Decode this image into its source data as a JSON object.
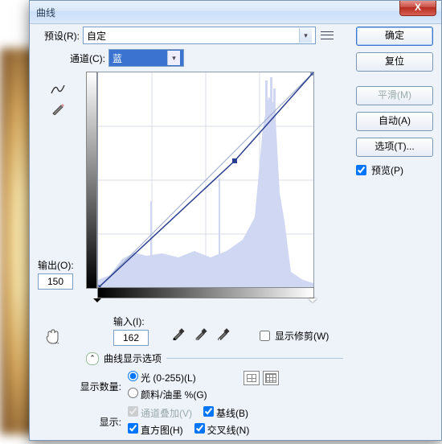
{
  "window": {
    "title": "曲线",
    "close": "X"
  },
  "preset": {
    "label": "预设(R):",
    "value": "自定"
  },
  "channel": {
    "label": "通道(C):",
    "value": "蓝"
  },
  "output": {
    "label": "输出(O):",
    "value": "150"
  },
  "input": {
    "label": "输入(I):",
    "value": "162"
  },
  "show_clip": "显示修剪(W)",
  "disclosure": "曲线显示选项",
  "display_amount": {
    "label": "显示数量:",
    "opt_light": "光 (0-255)(L)",
    "opt_pigment": "颜料/油墨 %(G)"
  },
  "display": {
    "label": "显示:",
    "overlay": "通道叠加(V)",
    "histogram": "直方图(H)",
    "baseline": "基线(B)",
    "intersection": "交叉线(N)"
  },
  "buttons": {
    "ok": "确定",
    "reset": "复位",
    "smooth": "平滑(M)",
    "auto": "自动(A)",
    "options": "选项(T)..."
  },
  "preview": "预览(P)",
  "chart_data": {
    "type": "line",
    "title": "",
    "xlabel": "输入",
    "ylabel": "输出",
    "xlim": [
      0,
      255
    ],
    "ylim": [
      0,
      255
    ],
    "grid": true,
    "series": [
      {
        "name": "curve",
        "points": [
          [
            0,
            0
          ],
          [
            162,
            150
          ],
          [
            255,
            255
          ]
        ]
      },
      {
        "name": "baseline",
        "points": [
          [
            0,
            0
          ],
          [
            255,
            255
          ]
        ]
      }
    ],
    "selected_point": [
      162,
      150
    ],
    "histogram_hint": "light blue histogram shown as background, tall peak near x≈210, broad low mass 40–180"
  }
}
